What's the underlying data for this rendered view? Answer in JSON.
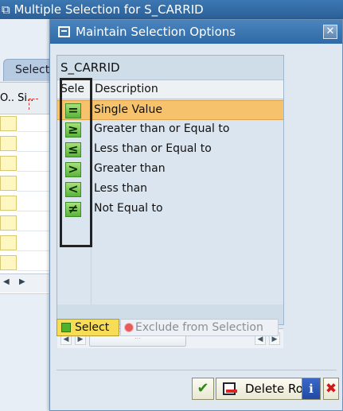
{
  "background_window": {
    "title": "Multiple Selection for S_CARRID",
    "tab_label": "Select",
    "grid_header": "O.. Si.."
  },
  "dialog": {
    "title": "Maintain Selection Options",
    "close_glyph": "✕",
    "panel_title": "S_CARRID",
    "columns": {
      "sign": "Sele",
      "description": "Description"
    },
    "rows": [
      {
        "symbol": "=",
        "label": "Single Value",
        "selected": true
      },
      {
        "symbol": "≥",
        "label": "Greater than or Equal to",
        "selected": false
      },
      {
        "symbol": "≤",
        "label": "Less than or Equal to",
        "selected": false
      },
      {
        "symbol": ">",
        "label": "Greater than",
        "selected": false
      },
      {
        "symbol": "<",
        "label": "Less than",
        "selected": false
      },
      {
        "symbol": "≠",
        "label": "Not Equal to",
        "selected": false
      }
    ],
    "select_button": "Select",
    "exclude_button": "Exclude from Selection",
    "footer": {
      "ok_glyph": "✔",
      "delete_row": "Delete Row",
      "info_glyph": "i",
      "cancel_glyph": "✖"
    }
  }
}
